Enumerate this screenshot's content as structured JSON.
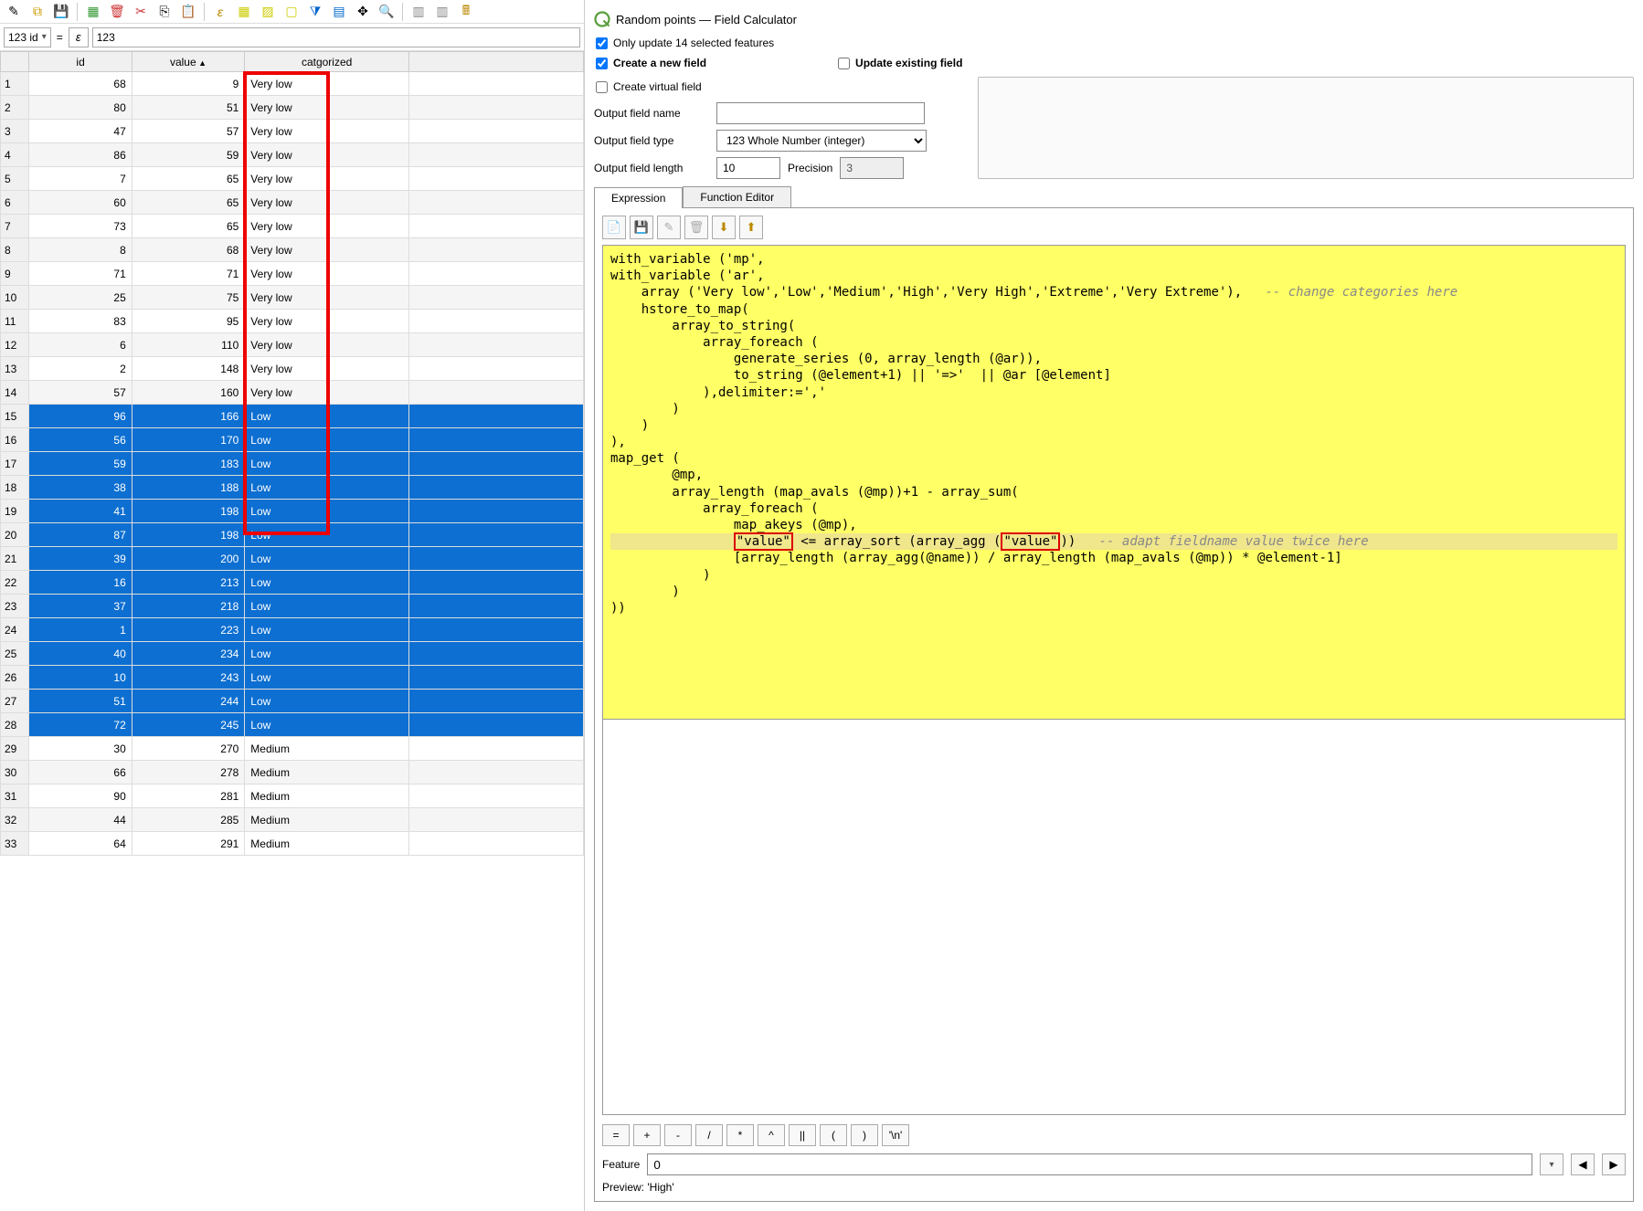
{
  "toolbar_icons": [
    "pencil",
    "multi-edit",
    "save",
    "new-field",
    "delete-field",
    "cut",
    "copy",
    "paste",
    "expr",
    "select-expr",
    "select-all",
    "invert",
    "filter",
    "pan",
    "zoom",
    "find",
    "form",
    "table-view",
    "cond-format"
  ],
  "filter_bar": {
    "field_label": "123 id",
    "epsilon": "ε",
    "value": "123"
  },
  "columns": [
    "id",
    "value",
    "catgorized"
  ],
  "sort_column": "value",
  "rows": [
    {
      "n": 1,
      "id": 68,
      "value": 9,
      "cat": "Very low",
      "sel": false
    },
    {
      "n": 2,
      "id": 80,
      "value": 51,
      "cat": "Very low",
      "sel": false
    },
    {
      "n": 3,
      "id": 47,
      "value": 57,
      "cat": "Very low",
      "sel": false
    },
    {
      "n": 4,
      "id": 86,
      "value": 59,
      "cat": "Very low",
      "sel": false
    },
    {
      "n": 5,
      "id": 7,
      "value": 65,
      "cat": "Very low",
      "sel": false
    },
    {
      "n": 6,
      "id": 60,
      "value": 65,
      "cat": "Very low",
      "sel": false
    },
    {
      "n": 7,
      "id": 73,
      "value": 65,
      "cat": "Very low",
      "sel": false
    },
    {
      "n": 8,
      "id": 8,
      "value": 68,
      "cat": "Very low",
      "sel": false
    },
    {
      "n": 9,
      "id": 71,
      "value": 71,
      "cat": "Very low",
      "sel": false
    },
    {
      "n": 10,
      "id": 25,
      "value": 75,
      "cat": "Very low",
      "sel": false
    },
    {
      "n": 11,
      "id": 83,
      "value": 95,
      "cat": "Very low",
      "sel": false
    },
    {
      "n": 12,
      "id": 6,
      "value": 110,
      "cat": "Very low",
      "sel": false
    },
    {
      "n": 13,
      "id": 2,
      "value": 148,
      "cat": "Very low",
      "sel": false
    },
    {
      "n": 14,
      "id": 57,
      "value": 160,
      "cat": "Very low",
      "sel": false
    },
    {
      "n": 15,
      "id": 96,
      "value": 166,
      "cat": "Low",
      "sel": true
    },
    {
      "n": 16,
      "id": 56,
      "value": 170,
      "cat": "Low",
      "sel": true
    },
    {
      "n": 17,
      "id": 59,
      "value": 183,
      "cat": "Low",
      "sel": true
    },
    {
      "n": 18,
      "id": 38,
      "value": 188,
      "cat": "Low",
      "sel": true
    },
    {
      "n": 19,
      "id": 41,
      "value": 198,
      "cat": "Low",
      "sel": true
    },
    {
      "n": 20,
      "id": 87,
      "value": 198,
      "cat": "Low",
      "sel": true
    },
    {
      "n": 21,
      "id": 39,
      "value": 200,
      "cat": "Low",
      "sel": true
    },
    {
      "n": 22,
      "id": 16,
      "value": 213,
      "cat": "Low",
      "sel": true
    },
    {
      "n": 23,
      "id": 37,
      "value": 218,
      "cat": "Low",
      "sel": true
    },
    {
      "n": 24,
      "id": 1,
      "value": 223,
      "cat": "Low",
      "sel": true
    },
    {
      "n": 25,
      "id": 40,
      "value": 234,
      "cat": "Low",
      "sel": true
    },
    {
      "n": 26,
      "id": 10,
      "value": 243,
      "cat": "Low",
      "sel": true
    },
    {
      "n": 27,
      "id": 51,
      "value": 244,
      "cat": "Low",
      "sel": true
    },
    {
      "n": 28,
      "id": 72,
      "value": 245,
      "cat": "Low",
      "sel": true
    },
    {
      "n": 29,
      "id": 30,
      "value": 270,
      "cat": "Medium",
      "sel": false
    },
    {
      "n": 30,
      "id": 66,
      "value": 278,
      "cat": "Medium",
      "sel": false
    },
    {
      "n": 31,
      "id": 90,
      "value": 281,
      "cat": "Medium",
      "sel": false
    },
    {
      "n": 32,
      "id": 44,
      "value": 285,
      "cat": "Medium",
      "sel": false
    },
    {
      "n": 33,
      "id": 64,
      "value": 291,
      "cat": "Medium",
      "sel": false
    }
  ],
  "dialog": {
    "title": "Random points — Field Calculator",
    "only_update": "Only update 14 selected features",
    "create_new": "Create a new field",
    "update_existing": "Update existing field",
    "create_virtual": "Create virtual field",
    "out_name_lbl": "Output field name",
    "out_name_val": "",
    "out_type_lbl": "Output field type",
    "out_type_val": "123 Whole Number (integer)",
    "out_len_lbl": "Output field length",
    "out_len_val": "10",
    "precision_lbl": "Precision",
    "precision_val": "3",
    "tab_expression": "Expression",
    "tab_function": "Function Editor",
    "operators": [
      "=",
      "+",
      "-",
      "/",
      "*",
      "^",
      "||",
      "(",
      ")",
      "'\\n'"
    ],
    "feature_lbl": "Feature",
    "feature_val": "0",
    "preview_lbl": "Preview:",
    "preview_val": "'High'"
  },
  "code_lines": [
    {
      "pre": "",
      "t": "with_variable ('mp',"
    },
    {
      "pre": "",
      "t": "with_variable ('ar',"
    },
    {
      "pre": "    ",
      "t": "array ('Very low','Low','Medium','High','Very High','Extreme','Very Extreme'),   ",
      "cmt": "-- change categories here"
    },
    {
      "pre": "    ",
      "t": "hstore_to_map("
    },
    {
      "pre": "        ",
      "t": "array_to_string("
    },
    {
      "pre": "            ",
      "t": "array_foreach ("
    },
    {
      "pre": "                ",
      "t": "generate_series (0, array_length (@ar)),"
    },
    {
      "pre": "                ",
      "t": "to_string (@element+1) || '=>'  || @ar [@element]"
    },
    {
      "pre": "            ",
      "t": "),delimiter:=','"
    },
    {
      "pre": "        ",
      "t": ")"
    },
    {
      "pre": "    ",
      "t": ")"
    },
    {
      "pre": "",
      "t": "),"
    },
    {
      "pre": "",
      "t": "map_get ("
    },
    {
      "pre": "        ",
      "t": "@mp,"
    },
    {
      "pre": "        ",
      "t": "array_length (map_avals (@mp))+1 - array_sum("
    },
    {
      "pre": "            ",
      "t": "array_foreach ("
    },
    {
      "pre": "                ",
      "t": "map_akeys (@mp),"
    },
    {
      "pre": "                ",
      "t": "",
      "hl": true,
      "val1": "\"value\"",
      "mid": " <= array_sort (array_agg (",
      "val2": "\"value\"",
      "post": "))   ",
      "cmt": "-- adapt fieldname value twice here"
    },
    {
      "pre": "                ",
      "t": "[array_length (array_agg(@name)) / array_length (map_avals (@mp)) * @element-1]"
    },
    {
      "pre": "            ",
      "t": ")"
    },
    {
      "pre": "        ",
      "t": ")"
    },
    {
      "pre": "",
      "t": "))"
    }
  ]
}
